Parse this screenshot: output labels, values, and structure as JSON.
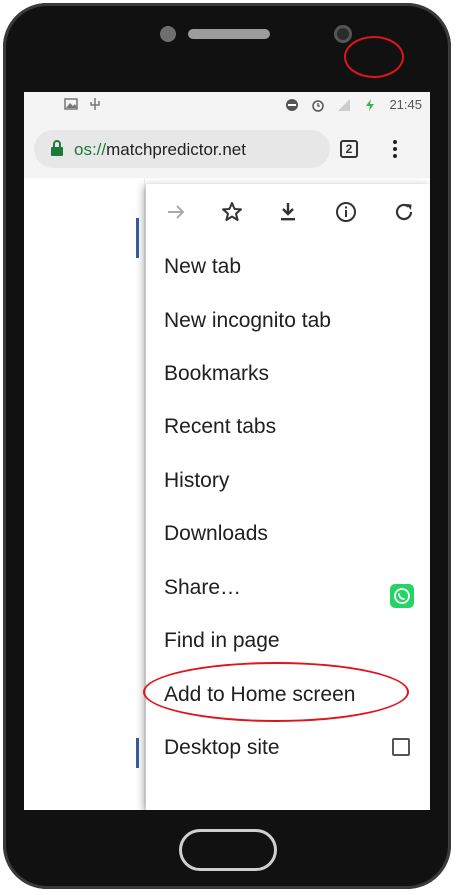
{
  "status_bar": {
    "time": "21:45"
  },
  "browser": {
    "url_scheme": "os://",
    "url_host": "matchpredictor.net",
    "tab_count": "2"
  },
  "menu": {
    "icons": [
      "forward-icon",
      "bookmark-star-icon",
      "download-icon",
      "info-icon",
      "refresh-icon"
    ],
    "items": [
      {
        "label": "New tab"
      },
      {
        "label": "New incognito tab"
      },
      {
        "label": "Bookmarks"
      },
      {
        "label": "Recent tabs"
      },
      {
        "label": "History"
      },
      {
        "label": "Downloads"
      },
      {
        "label": "Share…"
      },
      {
        "label": "Find in page"
      },
      {
        "label": "Add to Home screen"
      },
      {
        "label": "Desktop site"
      }
    ]
  },
  "colors": {
    "highlight_ring": "#e0151b",
    "whatsapp": "#25d366",
    "secure": "#1e7a3a"
  }
}
